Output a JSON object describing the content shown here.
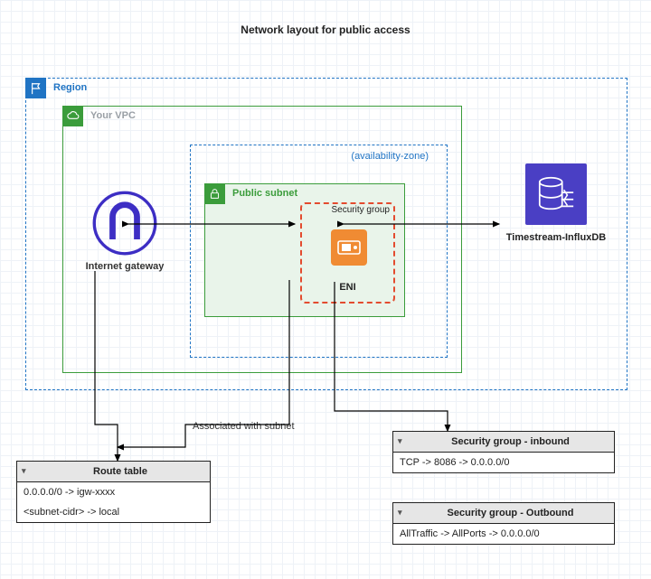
{
  "title": "Network layout for public access",
  "region": {
    "label": "Region"
  },
  "vpc": {
    "label": "Your VPC"
  },
  "az": {
    "label": "(availability-zone)"
  },
  "subnet": {
    "label": "Public subnet"
  },
  "security_group_box": {
    "label": "Security group"
  },
  "eni": {
    "label": "ENI"
  },
  "igw": {
    "label": "Internet gateway"
  },
  "db": {
    "label": "Timestream-InfluxDB"
  },
  "assoc_note": "Associated with subnet",
  "route_table": {
    "title": "Route table",
    "rows": [
      "0.0.0.0/0 -> igw-xxxx",
      "<subnet-cidr> -> local"
    ]
  },
  "sg_inbound": {
    "title": "Security group - inbound",
    "rows": [
      "TCP -> 8086 -> 0.0.0.0/0"
    ]
  },
  "sg_outbound": {
    "title": "Security group - Outbound",
    "rows": [
      "AllTraffic -> AllPorts -> 0.0.0.0/0"
    ]
  }
}
